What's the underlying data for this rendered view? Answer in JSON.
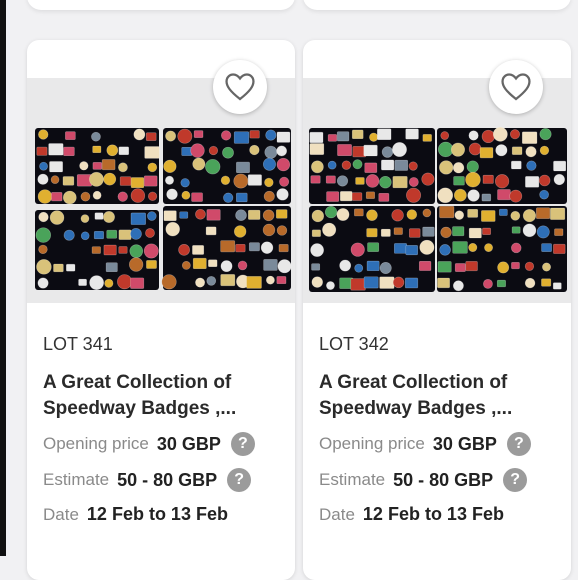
{
  "lots": [
    {
      "lot_label": "LOT 341",
      "title": "A Great Collection of Speedway Badges ,...",
      "opening_label": "Opening price",
      "opening_value": "30 GBP",
      "estimate_label": "Estimate",
      "estimate_value": "50 - 80 GBP",
      "date_label": "Date",
      "date_value": "12 Feb to 13 Feb",
      "favorite_icon": "heart-outline-icon",
      "help_icon": "question-circle-icon"
    },
    {
      "lot_label": "LOT 342",
      "title": "A Great Collection of Speedway Badges ,...",
      "opening_label": "Opening price",
      "opening_value": "30 GBP",
      "estimate_label": "Estimate",
      "estimate_value": "50 - 80 GBP",
      "date_label": "Date",
      "date_value": "12 Feb to 13 Feb",
      "favorite_icon": "heart-outline-icon",
      "help_icon": "question-circle-icon"
    }
  ],
  "colors": {
    "page_bg": "#f1f1f3",
    "card_bg": "#ffffff",
    "badge_tray": "#0b0b12",
    "help_icon_bg": "#9b9b9b"
  }
}
